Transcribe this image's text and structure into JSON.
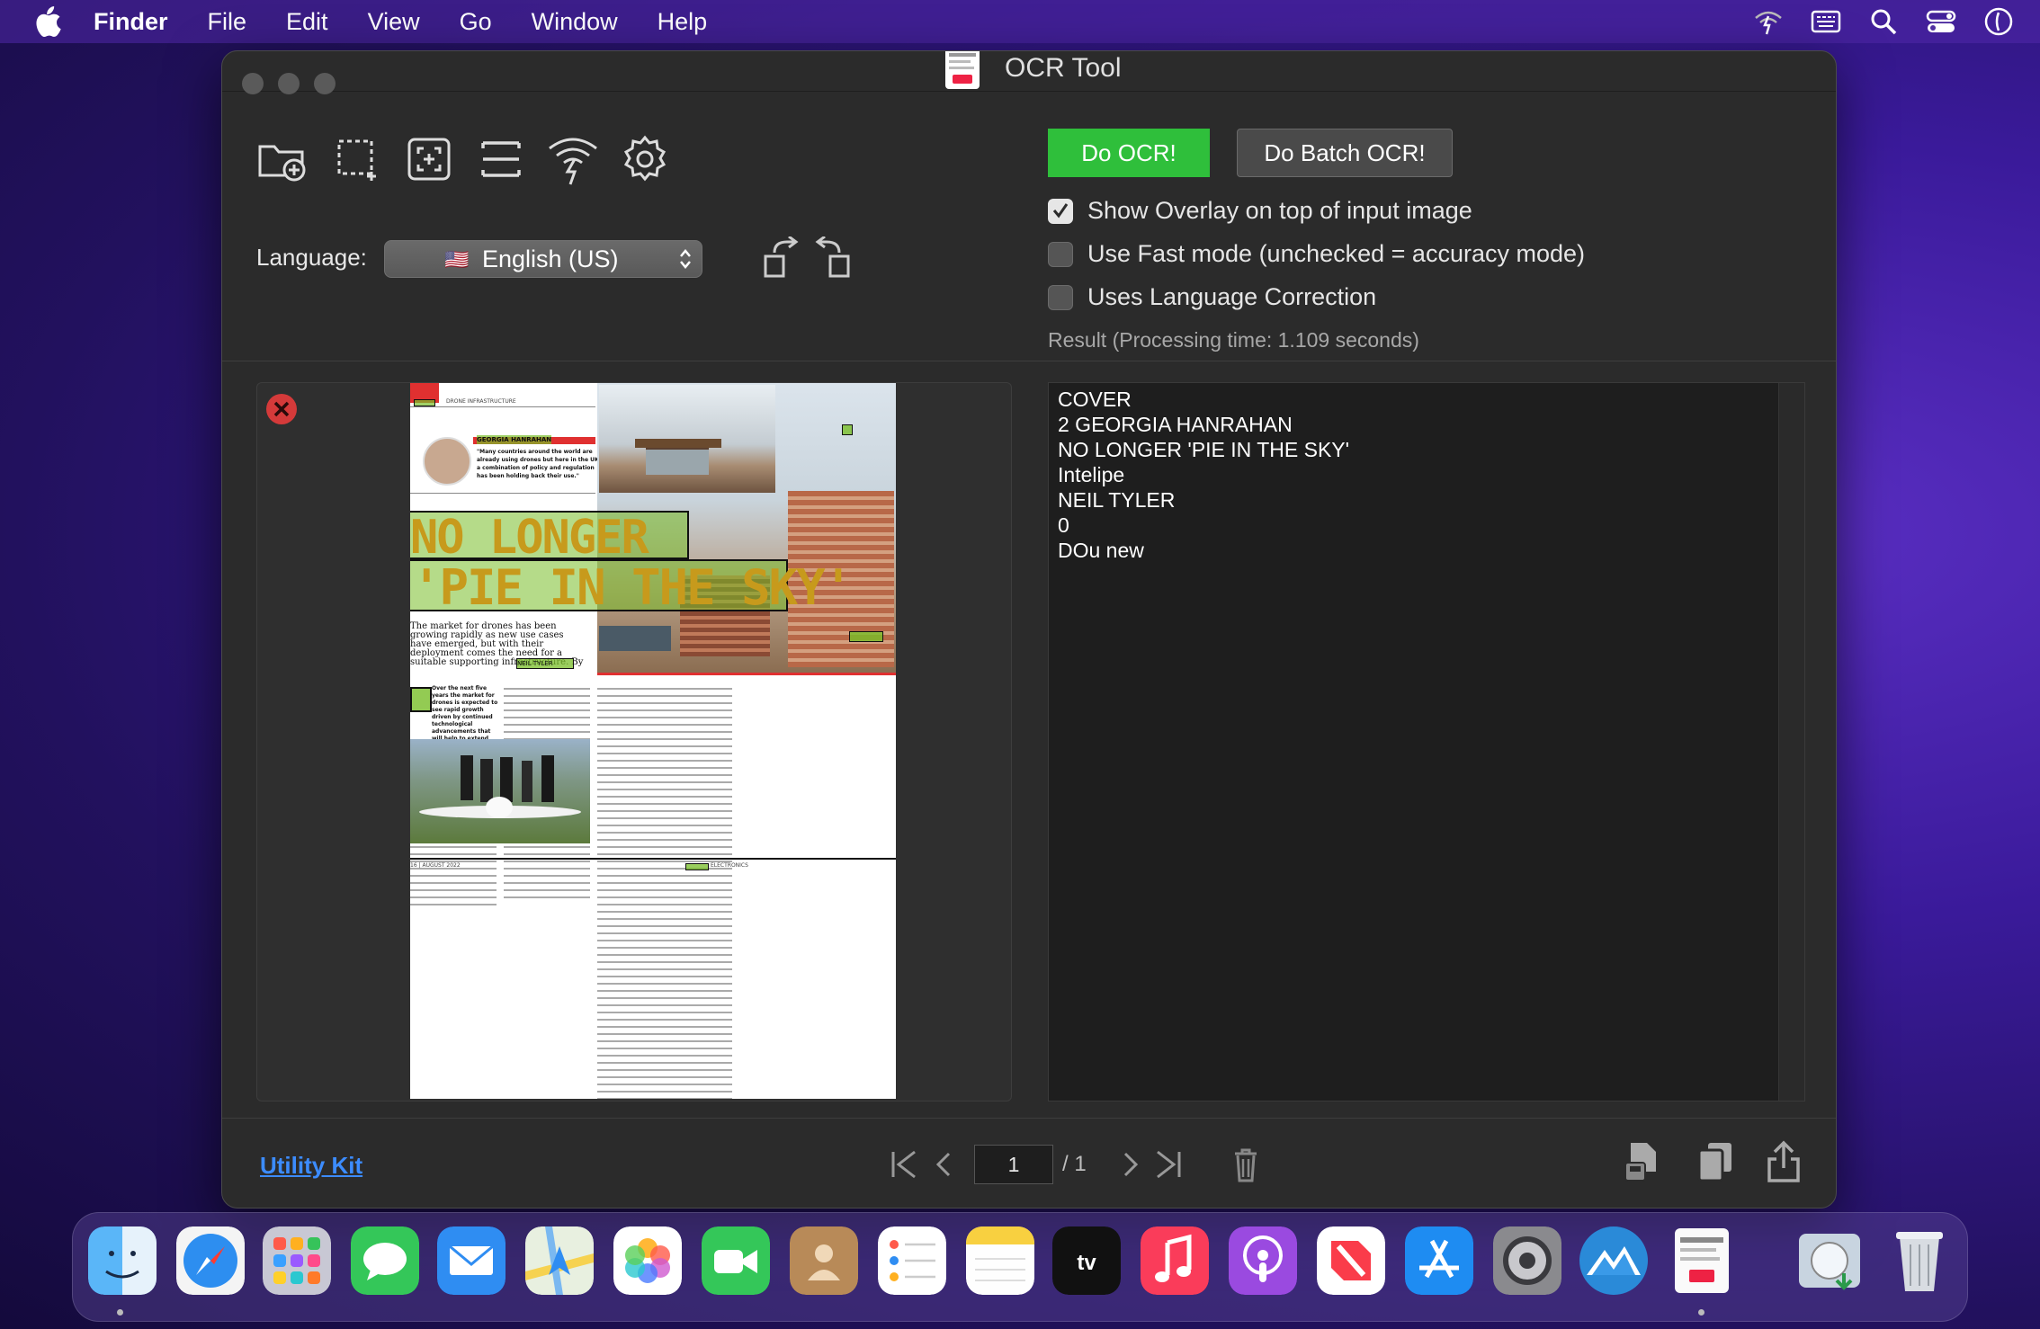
{
  "menubar": {
    "app_name": "Finder",
    "items": [
      "File",
      "Edit",
      "View",
      "Go",
      "Window",
      "Help"
    ]
  },
  "window": {
    "title": "OCR Tool"
  },
  "toolbar": {
    "icons": [
      "open-folder-icon",
      "select-region-icon",
      "capture-screen-icon",
      "scan-lines-icon",
      "wireless-charge-icon",
      "settings-gear-icon"
    ],
    "language_label": "Language:",
    "language_flag": "🇺🇸",
    "language_value": "English (US)",
    "do_ocr_label": "Do OCR!",
    "do_batch_label": "Do Batch OCR!",
    "ocr_button_color": "#2fbf3b"
  },
  "options": [
    {
      "label": "Show Overlay on top of input image",
      "checked": true
    },
    {
      "label": "Use Fast mode (unchecked = accuracy mode)",
      "checked": false
    },
    {
      "label": "Uses Language Correction",
      "checked": false
    }
  ],
  "result": {
    "label": "Result (Processing time: 1.109 seconds)",
    "text": "COVER\n2 GEORGIA HANRAHAN\nNO LONGER 'PIE IN THE SKY'\nIntelipe\nNEIL TYLER\n0\nDOu new"
  },
  "document": {
    "section": "DRONE INFRASTRUCTURE",
    "quote_name": "GEORGIA HANRAHAN",
    "quote": "\"Many countries around the world are already using drones but here in the UK a combination of policy and regulation has been holding back their use.\"",
    "headline_1": "NO LONGER",
    "headline_2": "'PIE IN THE SKY'",
    "standfirst": "The market for drones has been growing rapidly as new use cases have emerged, but with their deployment comes the need for a suitable supporting infrastructure. By",
    "byline": "NEIL TYLER",
    "lead": "Over the next five years the market for drones is expected to see rapid growth driven by continued technological advancements that will help to extend the range and the size of the payloads that drones will be able to handle.",
    "footer_left": "16 | AUGUST 2022",
    "footer_right": "ELECTRONICS"
  },
  "bottom_bar": {
    "utility_link": "Utility Kit",
    "page_current": "1",
    "page_total": "/ 1"
  },
  "dock": {
    "apps": [
      "finder",
      "safari",
      "launchpad",
      "messages",
      "mail",
      "maps",
      "photos",
      "facetime",
      "contacts",
      "reminders",
      "notes",
      "tv",
      "music",
      "podcasts",
      "news",
      "app-store",
      "system-settings",
      "monterey-installer",
      "ocr-tool",
      "macos-installer",
      "trash"
    ],
    "tv_label": "tv"
  }
}
